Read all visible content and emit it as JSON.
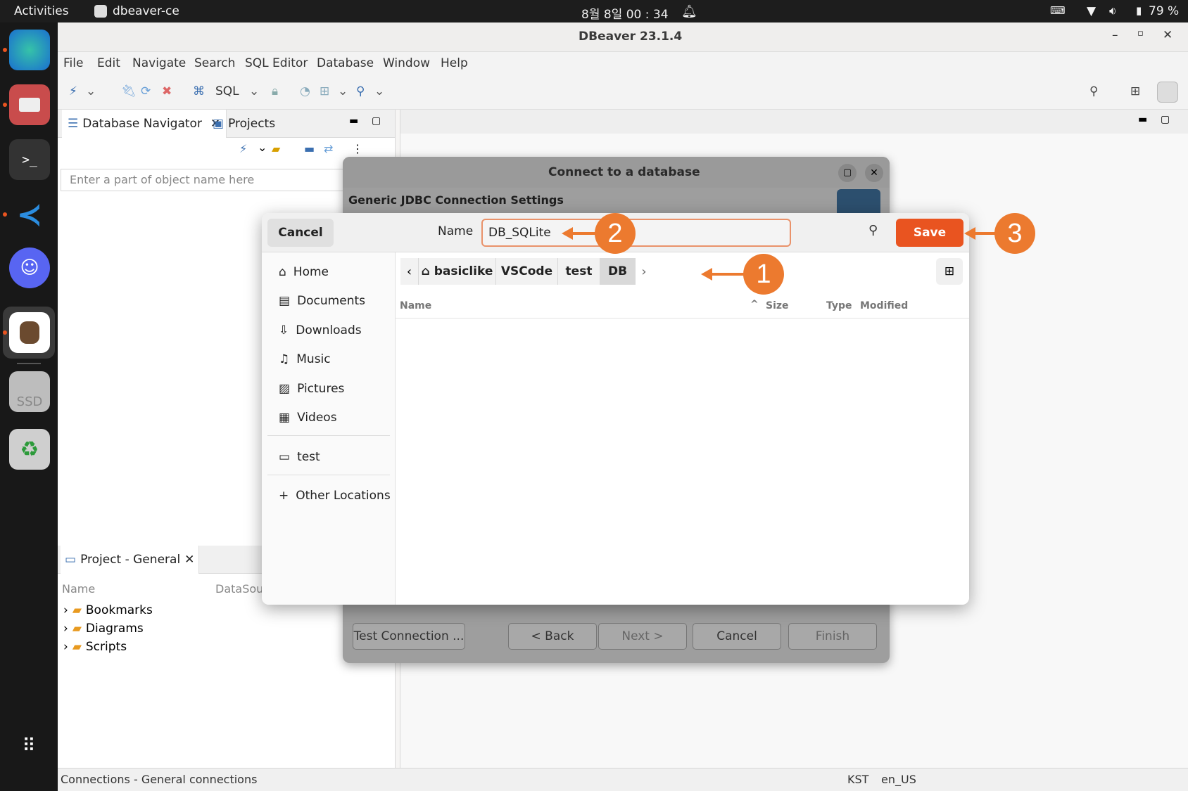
{
  "topbar": {
    "activities": "Activities",
    "app": "dbeaver-ce",
    "clock": "8월 8일  00 : 34",
    "battery": "79 %"
  },
  "window": {
    "title": "DBeaver 23.1.4"
  },
  "menu": [
    "File",
    "Edit",
    "Navigate",
    "Search",
    "SQL Editor",
    "Database",
    "Window",
    "Help"
  ],
  "toolbar": {
    "sql_label": "SQL"
  },
  "navigator": {
    "tab_db": "Database Navigator",
    "tab_projects": "Projects",
    "filter_placeholder": "Enter a part of object name here"
  },
  "project": {
    "tab": "Project - General",
    "col_name": "Name",
    "col_datasource": "DataSource",
    "items": [
      "Bookmarks",
      "Diagrams",
      "Scripts"
    ]
  },
  "status": {
    "left": "Connections - General connections",
    "tz": "KST",
    "locale": "en_US"
  },
  "conn_dialog": {
    "title": "Connect to a database",
    "subtitle": "Generic JDBC Connection Settings",
    "buttons": {
      "test": "Test Connection ...",
      "back": "< Back",
      "next": "Next >",
      "cancel": "Cancel",
      "finish": "Finish"
    }
  },
  "file_chooser": {
    "cancel": "Cancel",
    "name_label": "Name",
    "name_value": "DB_SQLite",
    "save": "Save",
    "places": [
      "Home",
      "Documents",
      "Downloads",
      "Music",
      "Pictures",
      "Videos"
    ],
    "bookmarks": [
      "test"
    ],
    "other": "Other Locations",
    "path": [
      "basiclike",
      "VSCode",
      "test",
      "DB"
    ],
    "columns": {
      "name": "Name",
      "size": "Size",
      "type": "Type",
      "modified": "Modified"
    }
  },
  "callouts": [
    "1",
    "2",
    "3"
  ],
  "colors": {
    "accent": "#e95420",
    "callout": "#ec7a2f",
    "selection": "#3b6fb0"
  }
}
